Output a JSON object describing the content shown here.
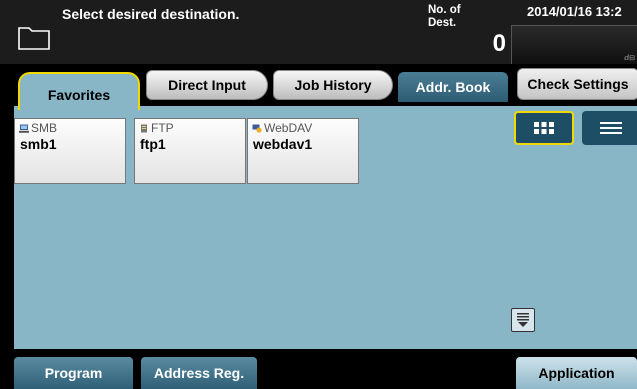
{
  "header": {
    "message": "Select desired destination.",
    "dest_label": "No. of\nDest.",
    "dest_count": "0",
    "datetime": "2014/01/16 13:2",
    "status_glyph": "ⅆ⊟"
  },
  "tabs": [
    {
      "label": "Favorites",
      "active": true
    },
    {
      "label": "Direct Input",
      "active": false
    },
    {
      "label": "Job History",
      "active": false
    },
    {
      "label": "Addr. Book",
      "active": false
    }
  ],
  "check_settings_label": "Check Settings",
  "destinations": [
    {
      "type": "SMB",
      "name": "smb1",
      "icon": "smb-computer-icon"
    },
    {
      "type": "FTP",
      "name": "ftp1",
      "icon": "ftp-server-icon"
    },
    {
      "type": "WebDAV",
      "name": "webdav1",
      "icon": "webdav-icon"
    }
  ],
  "view_modes": {
    "selected": "thumbnail-grid",
    "options": [
      "thumbnail-grid",
      "list"
    ]
  },
  "footer": {
    "program_label": "Program",
    "address_reg_label": "Address Reg.",
    "application_label": "Application"
  },
  "colors": {
    "content_bg": "#89b6c6",
    "selected_border": "#f2d700",
    "dark_button": "#2f6077",
    "header_bg": "#1c1c1c"
  }
}
